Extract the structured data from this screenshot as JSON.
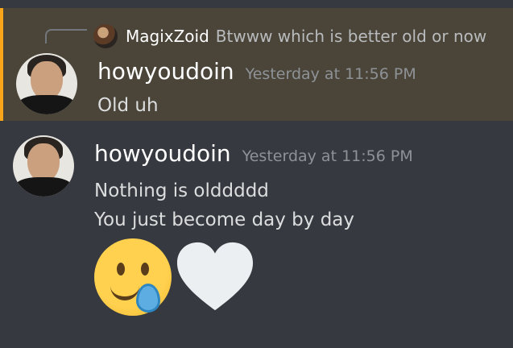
{
  "reply": {
    "author": "MagixZoid",
    "text": "Btwww which is better old or now"
  },
  "messages": [
    {
      "author": "howyoudoin",
      "timestamp": "Yesterday at 11:56 PM",
      "lines": [
        "Old uh"
      ]
    },
    {
      "author": "howyoudoin",
      "timestamp": "Yesterday at 11:56 PM",
      "lines": [
        "Nothing is olddddd",
        "You just become day by day"
      ],
      "emojis": [
        "smiling-face-with-tear-icon",
        "white-heart-icon"
      ]
    }
  ],
  "colors": {
    "background": "#36393f",
    "mention_highlight": "#4a4538",
    "mention_bar": "#faa61a"
  }
}
